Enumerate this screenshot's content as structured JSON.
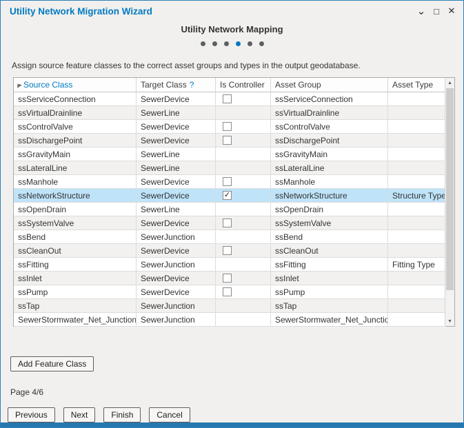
{
  "window": {
    "title": "Utility Network Migration Wizard",
    "controls": {
      "collapse_icon": "⌄",
      "maximize_icon": "□",
      "close_icon": "✕"
    }
  },
  "wizard": {
    "heading": "Utility Network Mapping",
    "step_count": 6,
    "active_step": 4,
    "page_label": "Page 4/6"
  },
  "instruction": "Assign source feature classes to the correct asset groups and types in the output geodatabase.",
  "table": {
    "headers": {
      "source": "Source Class",
      "target": "Target Class",
      "target_help": "?",
      "controller": "Is Controller",
      "asset_group": "Asset Group",
      "asset_type": "Asset Type"
    },
    "rows": [
      {
        "source": "ssServiceConnection",
        "target": "SewerDevice",
        "has_checkbox": true,
        "checked": false,
        "asset_group": "ssServiceConnection",
        "asset_type": "",
        "selected": false
      },
      {
        "source": "ssVirtualDrainline",
        "target": "SewerLine",
        "has_checkbox": false,
        "checked": false,
        "asset_group": "ssVirtualDrainline",
        "asset_type": "",
        "selected": false
      },
      {
        "source": "ssControlValve",
        "target": "SewerDevice",
        "has_checkbox": true,
        "checked": false,
        "asset_group": "ssControlValve",
        "asset_type": "",
        "selected": false
      },
      {
        "source": "ssDischargePoint",
        "target": "SewerDevice",
        "has_checkbox": true,
        "checked": false,
        "asset_group": "ssDischargePoint",
        "asset_type": "",
        "selected": false
      },
      {
        "source": "ssGravityMain",
        "target": "SewerLine",
        "has_checkbox": false,
        "checked": false,
        "asset_group": "ssGravityMain",
        "asset_type": "",
        "selected": false
      },
      {
        "source": "ssLateralLine",
        "target": "SewerLine",
        "has_checkbox": false,
        "checked": false,
        "asset_group": "ssLateralLine",
        "asset_type": "",
        "selected": false
      },
      {
        "source": "ssManhole",
        "target": "SewerDevice",
        "has_checkbox": true,
        "checked": false,
        "asset_group": "ssManhole",
        "asset_type": "",
        "selected": false
      },
      {
        "source": "ssNetworkStructure",
        "target": "SewerDevice",
        "has_checkbox": true,
        "checked": true,
        "asset_group": "ssNetworkStructure",
        "asset_type": "Structure Type",
        "selected": true
      },
      {
        "source": "ssOpenDrain",
        "target": "SewerLine",
        "has_checkbox": false,
        "checked": false,
        "asset_group": "ssOpenDrain",
        "asset_type": "",
        "selected": false
      },
      {
        "source": "ssSystemValve",
        "target": "SewerDevice",
        "has_checkbox": true,
        "checked": false,
        "asset_group": "ssSystemValve",
        "asset_type": "",
        "selected": false
      },
      {
        "source": "ssBend",
        "target": "SewerJunction",
        "has_checkbox": false,
        "checked": false,
        "asset_group": "ssBend",
        "asset_type": "",
        "selected": false
      },
      {
        "source": "ssCleanOut",
        "target": "SewerDevice",
        "has_checkbox": true,
        "checked": false,
        "asset_group": "ssCleanOut",
        "asset_type": "",
        "selected": false
      },
      {
        "source": "ssFitting",
        "target": "SewerJunction",
        "has_checkbox": false,
        "checked": false,
        "asset_group": "ssFitting",
        "asset_type": "Fitting Type",
        "selected": false
      },
      {
        "source": "ssInlet",
        "target": "SewerDevice",
        "has_checkbox": true,
        "checked": false,
        "asset_group": "ssInlet",
        "asset_type": "",
        "selected": false
      },
      {
        "source": "ssPump",
        "target": "SewerDevice",
        "has_checkbox": true,
        "checked": false,
        "asset_group": "ssPump",
        "asset_type": "",
        "selected": false
      },
      {
        "source": "ssTap",
        "target": "SewerJunction",
        "has_checkbox": false,
        "checked": false,
        "asset_group": "ssTap",
        "asset_type": "",
        "selected": false
      },
      {
        "source": "SewerStormwater_Net_Junctions",
        "target": "SewerJunction",
        "has_checkbox": false,
        "checked": false,
        "asset_group": "SewerStormwater_Net_Junctions",
        "asset_type": "",
        "selected": false
      }
    ]
  },
  "buttons": {
    "add_feature_class": "Add Feature Class",
    "previous": "Previous",
    "next": "Next",
    "finish": "Finish",
    "cancel": "Cancel"
  },
  "scrollbar": {
    "up_icon": "▲",
    "down_icon": "▼"
  },
  "colors": {
    "accent": "#0079c1",
    "selected_row": "#bfe3f8",
    "footer_bar": "#2679ae",
    "dialog_border": "#2e7fb8"
  }
}
